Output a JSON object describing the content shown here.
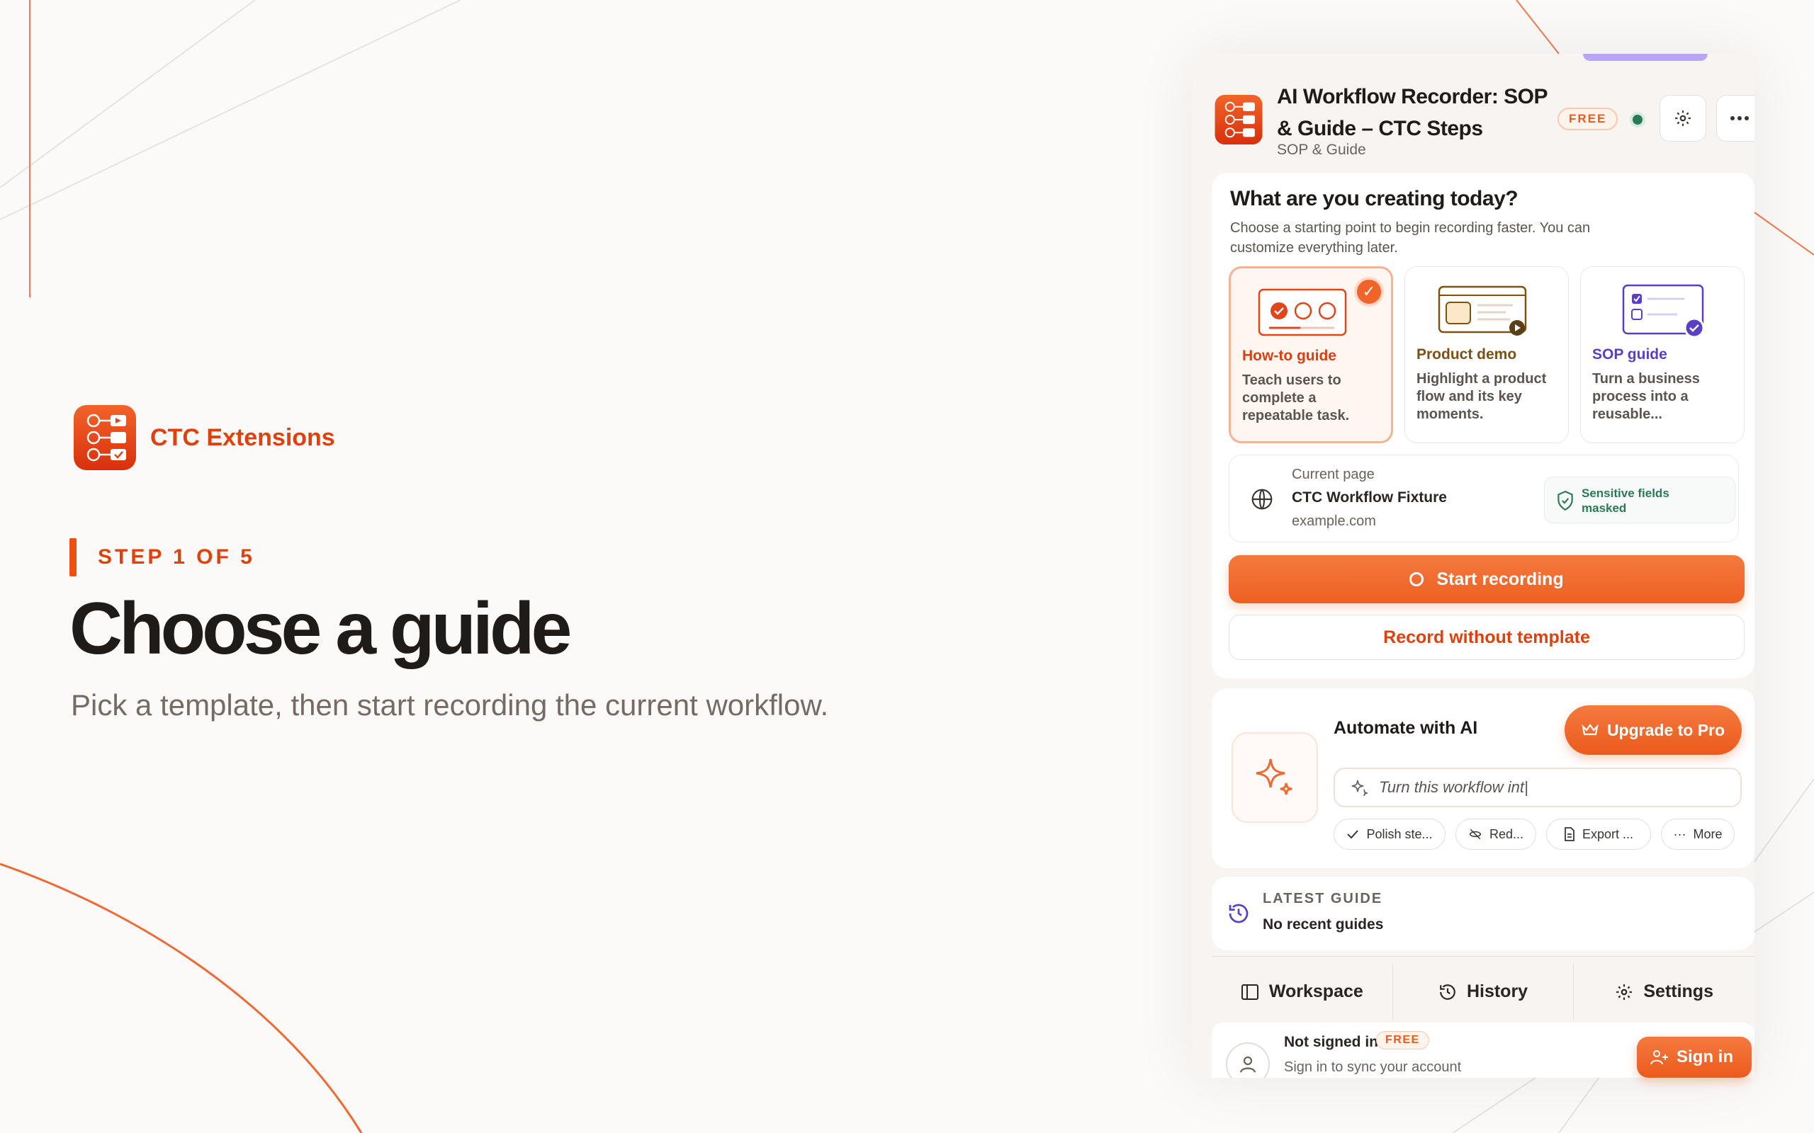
{
  "hero": {
    "brand_name": "CTC Extensions",
    "step": "STEP 1 OF 5",
    "title": "Choose a guide",
    "subtitle": "Pick a template, then start recording the current workflow."
  },
  "colors": {
    "accent": "#ef5a1c",
    "accent_text": "#e0410c",
    "status_green": "#2a7a56",
    "sop_purple": "#5a3fc6"
  },
  "panel": {
    "header": {
      "title": "AI Workflow Recorder: SOP & Guide – CTC Steps",
      "subtitle": "SOP & Guide",
      "badge": "FREE",
      "settings_icon": "gear-icon",
      "more_icon": "more-horizontal-icon"
    },
    "create": {
      "title": "What are you creating today?",
      "description": "Choose a starting point to begin recording faster. You can customize everything later.",
      "templates": [
        {
          "name": "How-to guide",
          "description": "Teach users to complete a repeatable task.",
          "selected": true
        },
        {
          "name": "Product demo",
          "description": "Highlight a product flow and its key moments.",
          "selected": false
        },
        {
          "name": "SOP guide",
          "description": "Turn a business process into a reusable...",
          "selected": false
        }
      ],
      "current_page": {
        "label": "Current page",
        "name": "CTC Workflow Fixture",
        "domain": "example.com",
        "privacy": "Sensitive fields masked"
      },
      "start_button": "Start recording",
      "no_template_button": "Record without template"
    },
    "ai": {
      "title": "Automate with AI",
      "upgrade_button": "Upgrade to Pro",
      "input_value": "Turn this workflow int|",
      "chips": [
        "Polish ste...",
        "Red...",
        "Export ...",
        "More"
      ]
    },
    "latest": {
      "label": "LATEST GUIDE",
      "value": "No recent guides"
    },
    "tabs": [
      "Workspace",
      "History",
      "Settings"
    ],
    "account": {
      "name": "Not signed in",
      "badge": "FREE",
      "subtitle": "Sign in to sync your account",
      "signin_button": "Sign in"
    }
  }
}
